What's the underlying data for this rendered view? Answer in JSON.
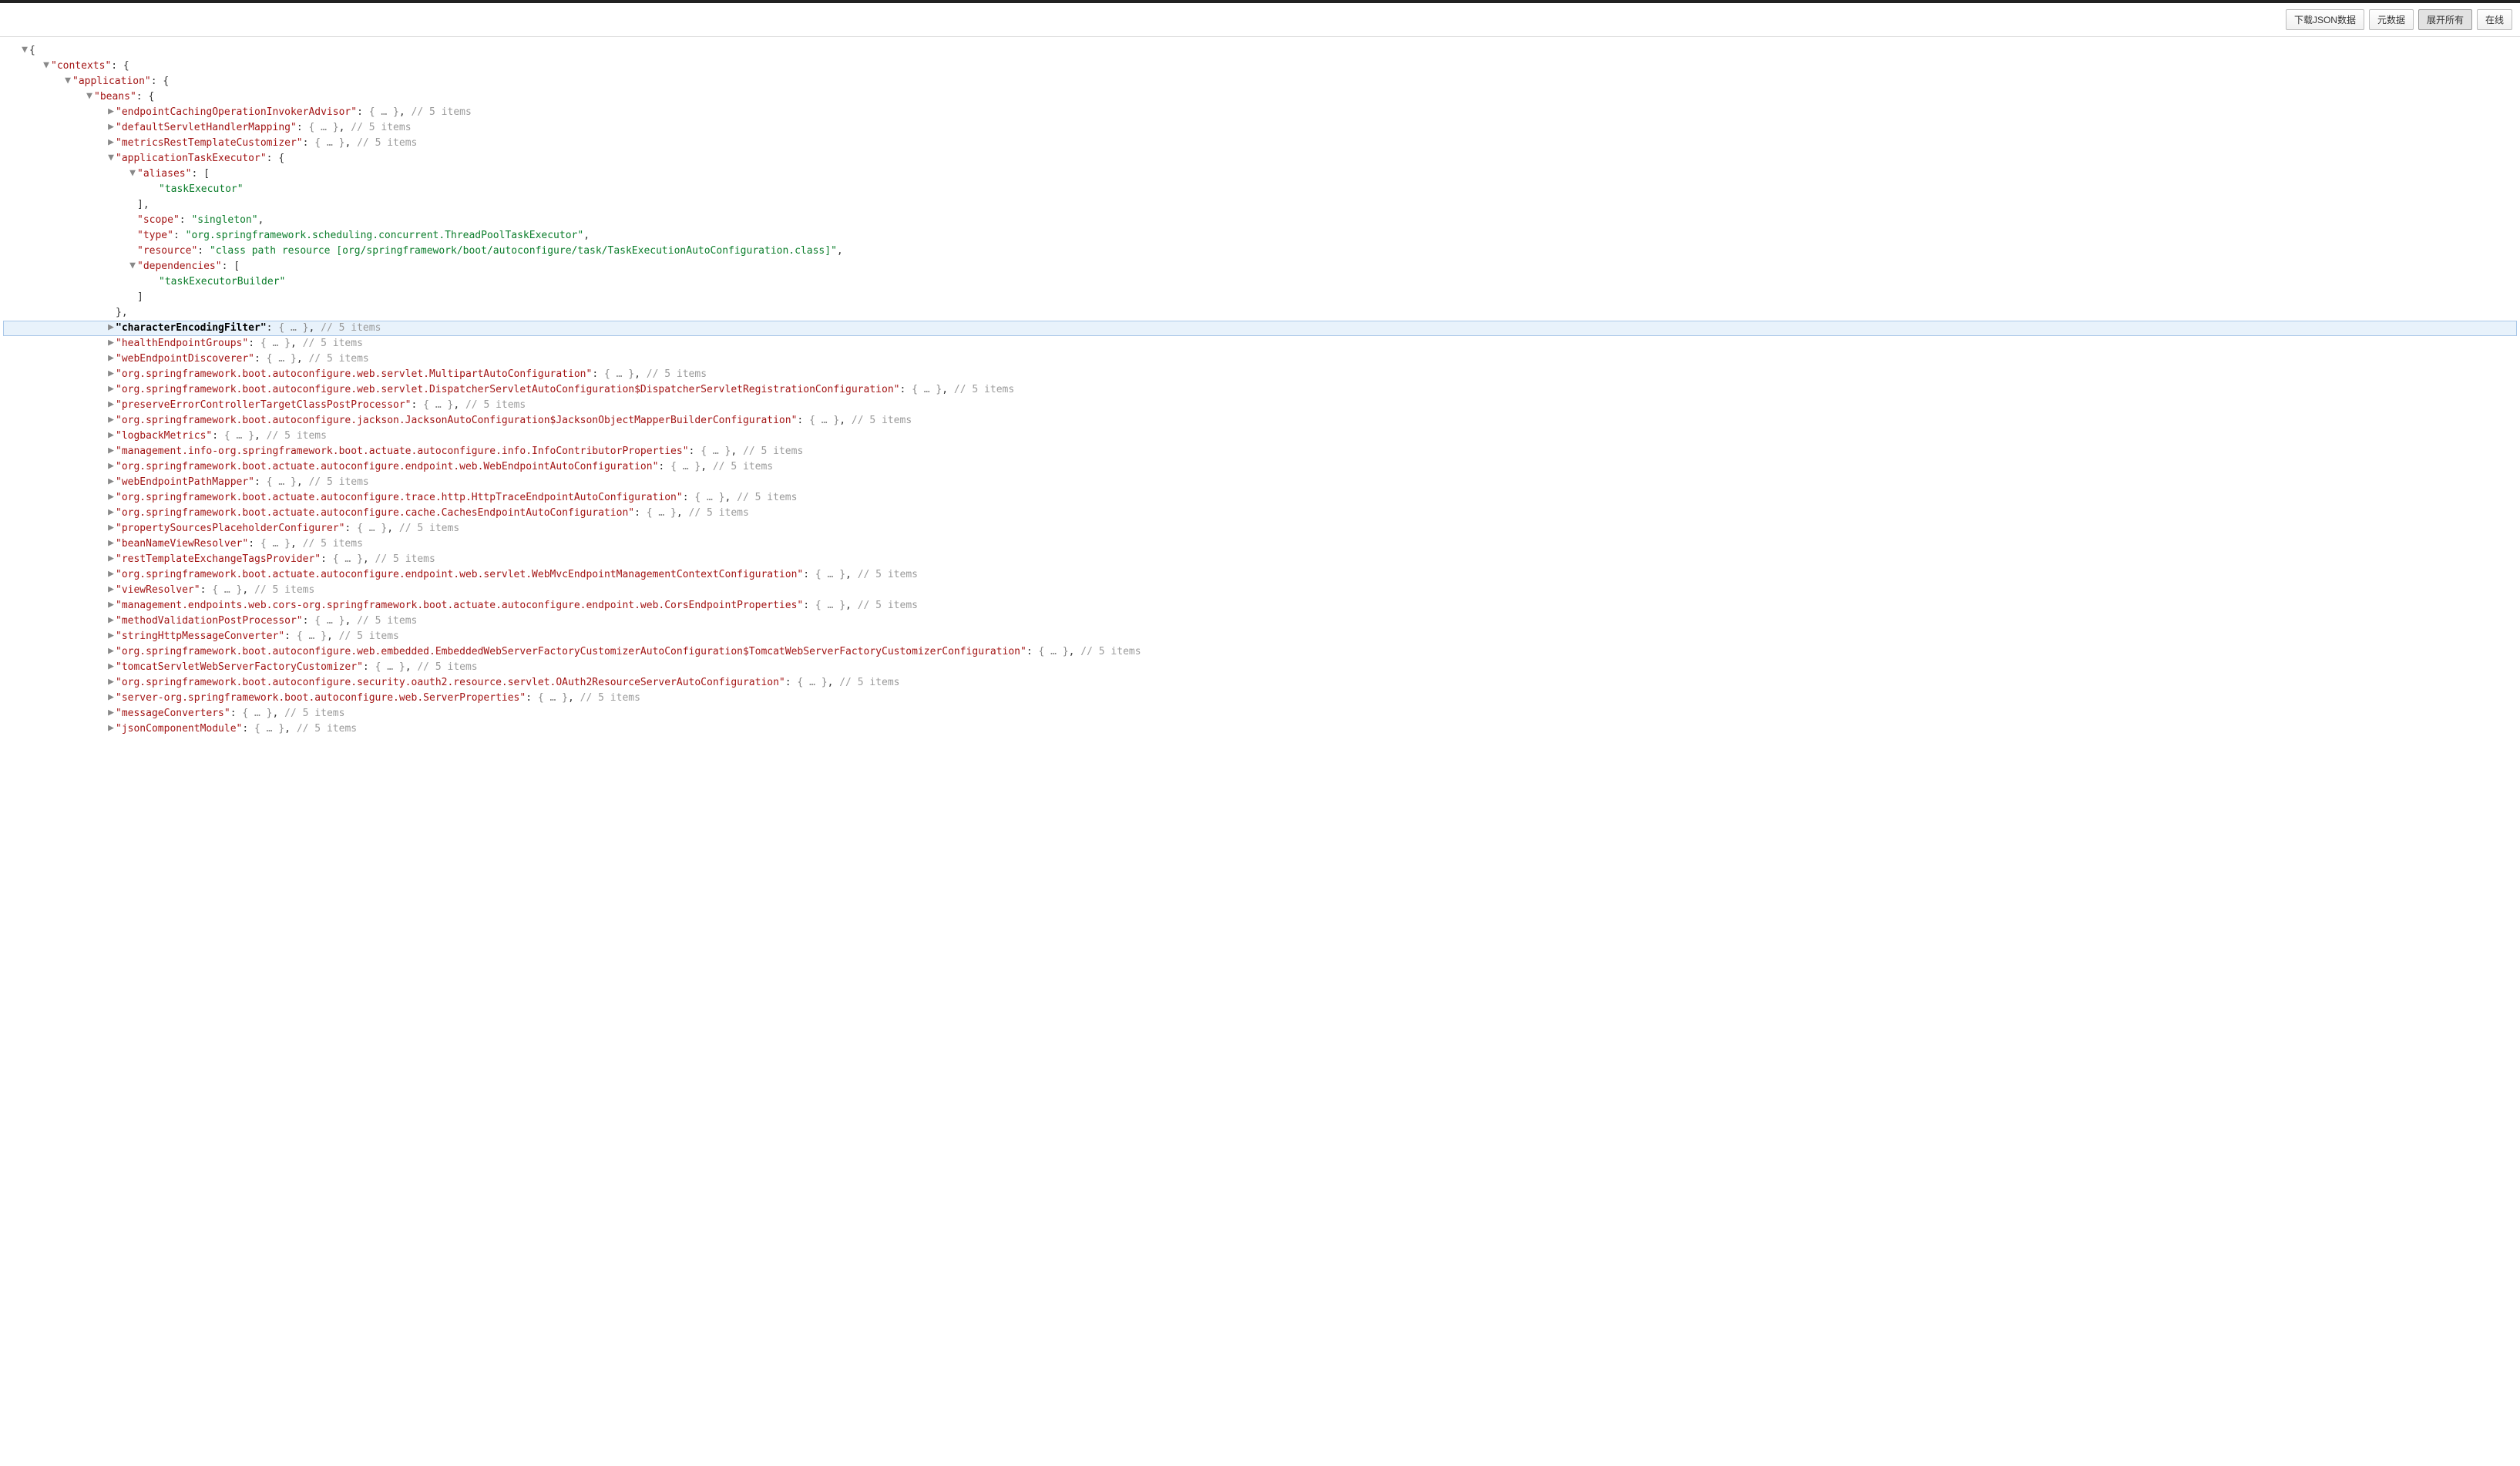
{
  "toolbar": {
    "download": "下载JSON数据",
    "metadata": "元数据",
    "expand": "展开所有",
    "online": "在线"
  },
  "tree": {
    "root_open": "{",
    "contexts_key": "contexts",
    "application_key": "application",
    "beans_key": "beans",
    "appTaskExec": {
      "key": "applicationTaskExecutor",
      "aliases_key": "aliases",
      "aliases_val": "taskExecutor",
      "scope_key": "scope",
      "scope_val": "singleton",
      "type_key": "type",
      "type_val": "org.springframework.scheduling.concurrent.ThreadPoolTaskExecutor",
      "resource_key": "resource",
      "resource_val": "class path resource [org/springframework/boot/autoconfigure/task/TaskExecutionAutoConfiguration.class]",
      "deps_key": "dependencies",
      "deps_val": "taskExecutorBuilder"
    },
    "collapsed": [
      {
        "key": "endpointCachingOperationInvokerAdvisor",
        "count": "5"
      },
      {
        "key": "defaultServletHandlerMapping",
        "count": "5"
      },
      {
        "key": "metricsRestTemplateCustomizer",
        "count": "5"
      },
      {
        "key": "characterEncodingFilter",
        "count": "5",
        "bold": true,
        "selected": true
      },
      {
        "key": "healthEndpointGroups",
        "count": "5"
      },
      {
        "key": "webEndpointDiscoverer",
        "count": "5"
      },
      {
        "key": "org.springframework.boot.autoconfigure.web.servlet.MultipartAutoConfiguration",
        "count": "5"
      },
      {
        "key": "org.springframework.boot.autoconfigure.web.servlet.DispatcherServletAutoConfiguration$DispatcherServletRegistrationConfiguration",
        "count": "5"
      },
      {
        "key": "preserveErrorControllerTargetClassPostProcessor",
        "count": "5"
      },
      {
        "key": "org.springframework.boot.autoconfigure.jackson.JacksonAutoConfiguration$JacksonObjectMapperBuilderConfiguration",
        "count": "5"
      },
      {
        "key": "logbackMetrics",
        "count": "5"
      },
      {
        "key": "management.info-org.springframework.boot.actuate.autoconfigure.info.InfoContributorProperties",
        "count": "5"
      },
      {
        "key": "org.springframework.boot.actuate.autoconfigure.endpoint.web.WebEndpointAutoConfiguration",
        "count": "5"
      },
      {
        "key": "webEndpointPathMapper",
        "count": "5"
      },
      {
        "key": "org.springframework.boot.actuate.autoconfigure.trace.http.HttpTraceEndpointAutoConfiguration",
        "count": "5"
      },
      {
        "key": "org.springframework.boot.actuate.autoconfigure.cache.CachesEndpointAutoConfiguration",
        "count": "5"
      },
      {
        "key": "propertySourcesPlaceholderConfigurer",
        "count": "5"
      },
      {
        "key": "beanNameViewResolver",
        "count": "5"
      },
      {
        "key": "restTemplateExchangeTagsProvider",
        "count": "5"
      },
      {
        "key": "org.springframework.boot.actuate.autoconfigure.endpoint.web.servlet.WebMvcEndpointManagementContextConfiguration",
        "count": "5"
      },
      {
        "key": "viewResolver",
        "count": "5"
      },
      {
        "key": "management.endpoints.web.cors-org.springframework.boot.actuate.autoconfigure.endpoint.web.CorsEndpointProperties",
        "count": "5"
      },
      {
        "key": "methodValidationPostProcessor",
        "count": "5"
      },
      {
        "key": "stringHttpMessageConverter",
        "count": "5"
      },
      {
        "key": "org.springframework.boot.autoconfigure.web.embedded.EmbeddedWebServerFactoryCustomizerAutoConfiguration$TomcatWebServerFactoryCustomizerConfiguration",
        "count": "5"
      },
      {
        "key": "tomcatServletWebServerFactoryCustomizer",
        "count": "5"
      },
      {
        "key": "org.springframework.boot.autoconfigure.security.oauth2.resource.servlet.OAuth2ResourceServerAutoConfiguration",
        "count": "5"
      },
      {
        "key": "server-org.springframework.boot.autoconfigure.web.ServerProperties",
        "count": "5"
      },
      {
        "key": "messageConverters",
        "count": "5"
      },
      {
        "key": "jsonComponentModule",
        "count": "5"
      }
    ],
    "items_word": "items",
    "obj_placeholder": "{ … }"
  },
  "glyph": {
    "open": "▼",
    "closed": "▶"
  }
}
